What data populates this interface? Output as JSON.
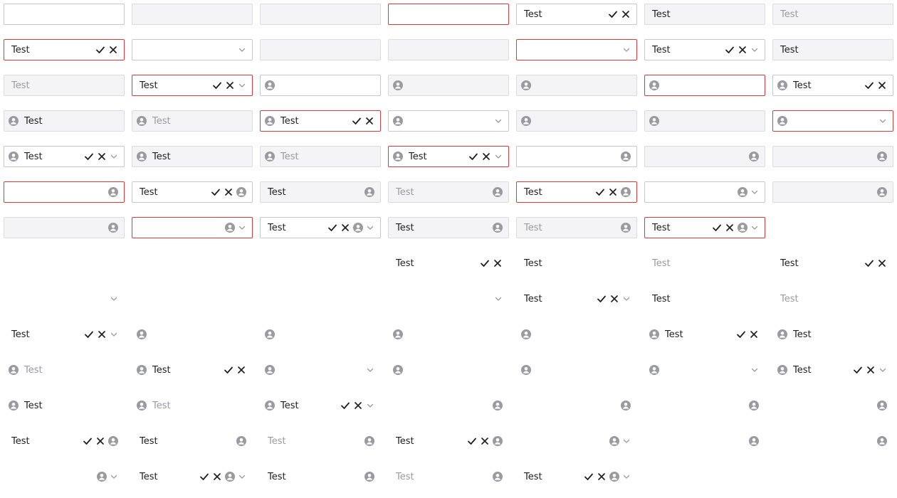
{
  "colors": {
    "error_border": "#d93a3a",
    "default_border": "#c8c8cc",
    "disabled_bg": "#f4f4f6",
    "placeholder": "#9a9aa2",
    "icon_gray": "#9a9aa2"
  },
  "icons": {
    "check": "check-icon",
    "close": "close-icon",
    "user": "user-icon",
    "chevron": "chevron-down-icon"
  },
  "rows": [
    [
      {
        "variant": "default",
        "value": "",
        "lead": false,
        "actions": false,
        "end": false,
        "chev": false
      },
      {
        "variant": "disabled",
        "value": "",
        "lead": false,
        "actions": false,
        "end": false,
        "chev": false
      },
      {
        "variant": "disabled",
        "value": "",
        "lead": false,
        "actions": false,
        "end": false,
        "chev": false
      },
      {
        "variant": "error",
        "value": "",
        "lead": false,
        "actions": false,
        "end": false,
        "chev": false
      },
      {
        "variant": "default",
        "value": "Test",
        "lead": false,
        "actions": true,
        "end": false,
        "chev": false
      },
      {
        "variant": "disabled",
        "value": "Test",
        "lead": false,
        "actions": false,
        "end": false,
        "chev": false
      },
      {
        "variant": "disabled",
        "value": "Test",
        "ph": true,
        "lead": false,
        "actions": false,
        "end": false,
        "chev": false
      }
    ],
    [
      {
        "variant": "error",
        "value": "Test",
        "lead": false,
        "actions": true,
        "end": false,
        "chev": false
      },
      {
        "variant": "default",
        "value": "",
        "lead": false,
        "actions": false,
        "end": false,
        "chev": true
      },
      {
        "variant": "disabled",
        "value": "",
        "lead": false,
        "actions": false,
        "end": false,
        "chev": false
      },
      {
        "variant": "disabled",
        "value": "",
        "lead": false,
        "actions": false,
        "end": false,
        "chev": false
      },
      {
        "variant": "error",
        "value": "",
        "lead": false,
        "actions": false,
        "end": false,
        "chev": true
      },
      {
        "variant": "default",
        "value": "Test",
        "lead": false,
        "actions": true,
        "end": false,
        "chev": true
      },
      {
        "variant": "disabled",
        "value": "Test",
        "lead": false,
        "actions": false,
        "end": false,
        "chev": false
      }
    ],
    [
      {
        "variant": "disabled",
        "value": "Test",
        "ph": true,
        "lead": false,
        "actions": false,
        "end": false,
        "chev": false
      },
      {
        "variant": "error",
        "value": "Test",
        "lead": false,
        "actions": true,
        "end": false,
        "chev": true
      },
      {
        "variant": "default",
        "value": "",
        "lead": true,
        "actions": false,
        "end": false,
        "chev": false
      },
      {
        "variant": "disabled",
        "value": "",
        "lead": true,
        "actions": false,
        "end": false,
        "chev": false
      },
      {
        "variant": "disabled",
        "value": "",
        "lead": true,
        "actions": false,
        "end": false,
        "chev": false
      },
      {
        "variant": "error",
        "value": "",
        "lead": true,
        "actions": false,
        "end": false,
        "chev": false
      },
      {
        "variant": "default",
        "value": "Test",
        "lead": true,
        "actions": true,
        "end": false,
        "chev": false
      }
    ],
    [
      {
        "variant": "disabled",
        "value": "Test",
        "lead": true,
        "actions": false,
        "end": false,
        "chev": false
      },
      {
        "variant": "disabled",
        "value": "Test",
        "ph": true,
        "lead": true,
        "actions": false,
        "end": false,
        "chev": false
      },
      {
        "variant": "error",
        "value": "Test",
        "lead": true,
        "actions": true,
        "end": false,
        "chev": false
      },
      {
        "variant": "default",
        "value": "",
        "lead": true,
        "actions": false,
        "end": false,
        "chev": true
      },
      {
        "variant": "disabled",
        "value": "",
        "lead": true,
        "actions": false,
        "end": false,
        "chev": false
      },
      {
        "variant": "disabled",
        "value": "",
        "lead": true,
        "actions": false,
        "end": false,
        "chev": false
      },
      {
        "variant": "error",
        "value": "",
        "lead": true,
        "actions": false,
        "end": false,
        "chev": true
      }
    ],
    [
      {
        "variant": "default",
        "value": "Test",
        "lead": true,
        "actions": true,
        "end": false,
        "chev": true
      },
      {
        "variant": "disabled",
        "value": "Test",
        "lead": true,
        "actions": false,
        "end": false,
        "chev": false
      },
      {
        "variant": "disabled",
        "value": "Test",
        "ph": true,
        "lead": true,
        "actions": false,
        "end": false,
        "chev": false
      },
      {
        "variant": "error",
        "value": "Test",
        "lead": true,
        "actions": true,
        "end": false,
        "chev": true
      },
      {
        "variant": "default",
        "value": "",
        "lead": false,
        "actions": false,
        "end": true,
        "chev": false
      },
      {
        "variant": "disabled",
        "value": "",
        "lead": false,
        "actions": false,
        "end": true,
        "chev": false
      },
      {
        "variant": "disabled",
        "value": "",
        "lead": false,
        "actions": false,
        "end": true,
        "chev": false
      }
    ],
    [
      {
        "variant": "error",
        "value": "",
        "lead": false,
        "actions": false,
        "end": true,
        "chev": false
      },
      {
        "variant": "default",
        "value": "Test",
        "lead": false,
        "actions": true,
        "end": true,
        "chev": false
      },
      {
        "variant": "disabled",
        "value": "Test",
        "lead": false,
        "actions": false,
        "end": true,
        "chev": false
      },
      {
        "variant": "disabled",
        "value": "Test",
        "ph": true,
        "lead": false,
        "actions": false,
        "end": true,
        "chev": false
      },
      {
        "variant": "error",
        "value": "Test",
        "lead": false,
        "actions": true,
        "end": true,
        "chev": false
      },
      {
        "variant": "default",
        "value": "",
        "lead": false,
        "actions": false,
        "end": true,
        "chev": true
      },
      {
        "variant": "disabled",
        "value": "",
        "lead": false,
        "actions": false,
        "end": true,
        "chev": false
      }
    ],
    [
      {
        "variant": "disabled",
        "value": "",
        "lead": false,
        "actions": false,
        "end": true,
        "chev": false
      },
      {
        "variant": "error",
        "value": "",
        "lead": false,
        "actions": false,
        "end": true,
        "chev": true
      },
      {
        "variant": "default",
        "value": "Test",
        "lead": false,
        "actions": true,
        "end": true,
        "chev": true
      },
      {
        "variant": "disabled",
        "value": "Test",
        "lead": false,
        "actions": false,
        "end": true,
        "chev": false
      },
      {
        "variant": "disabled",
        "value": "Test",
        "ph": true,
        "lead": false,
        "actions": false,
        "end": true,
        "chev": false
      },
      {
        "variant": "error",
        "value": "Test",
        "lead": false,
        "actions": true,
        "end": true,
        "chev": true
      },
      null
    ],
    [
      {
        "variant": "plain",
        "value": "",
        "lead": false,
        "actions": false,
        "end": false,
        "chev": false
      },
      {
        "variant": "plain",
        "value": "",
        "lead": false,
        "actions": false,
        "end": false,
        "chev": false
      },
      {
        "variant": "plain",
        "value": "",
        "lead": false,
        "actions": false,
        "end": false,
        "chev": false
      },
      {
        "variant": "plain",
        "value": "Test",
        "lead": false,
        "actions": true,
        "end": false,
        "chev": false
      },
      {
        "variant": "plain",
        "value": "Test",
        "lead": false,
        "actions": false,
        "end": false,
        "chev": false
      },
      {
        "variant": "plain",
        "value": "Test",
        "ph": true,
        "lead": false,
        "actions": false,
        "end": false,
        "chev": false
      },
      {
        "variant": "plain",
        "value": "Test",
        "lead": false,
        "actions": true,
        "end": false,
        "chev": false
      }
    ],
    [
      {
        "variant": "plain",
        "value": "",
        "lead": false,
        "actions": false,
        "end": false,
        "chev": true
      },
      {
        "variant": "plain",
        "value": "",
        "lead": false,
        "actions": false,
        "end": false,
        "chev": false
      },
      {
        "variant": "plain",
        "value": "",
        "lead": false,
        "actions": false,
        "end": false,
        "chev": false
      },
      {
        "variant": "plain",
        "value": "",
        "lead": false,
        "actions": false,
        "end": false,
        "chev": true
      },
      {
        "variant": "plain",
        "value": "Test",
        "lead": false,
        "actions": true,
        "end": false,
        "chev": true
      },
      {
        "variant": "plain",
        "value": "Test",
        "lead": false,
        "actions": false,
        "end": false,
        "chev": false
      },
      {
        "variant": "plain",
        "value": "Test",
        "ph": true,
        "lead": false,
        "actions": false,
        "end": false,
        "chev": false
      }
    ],
    [
      {
        "variant": "plain",
        "value": "Test",
        "lead": false,
        "actions": true,
        "end": false,
        "chev": true
      },
      {
        "variant": "plain",
        "value": "",
        "lead": true,
        "actions": false,
        "end": false,
        "chev": false
      },
      {
        "variant": "plain",
        "value": "",
        "lead": true,
        "actions": false,
        "end": false,
        "chev": false
      },
      {
        "variant": "plain",
        "value": "",
        "lead": true,
        "actions": false,
        "end": false,
        "chev": false
      },
      {
        "variant": "plain",
        "value": "",
        "lead": true,
        "actions": false,
        "end": false,
        "chev": false
      },
      {
        "variant": "plain",
        "value": "Test",
        "lead": true,
        "actions": true,
        "end": false,
        "chev": false
      },
      {
        "variant": "plain",
        "value": "Test",
        "lead": true,
        "actions": false,
        "end": false,
        "chev": false
      }
    ],
    [
      {
        "variant": "plain",
        "value": "Test",
        "ph": true,
        "lead": true,
        "actions": false,
        "end": false,
        "chev": false
      },
      {
        "variant": "plain",
        "value": "Test",
        "lead": true,
        "actions": true,
        "end": false,
        "chev": false
      },
      {
        "variant": "plain",
        "value": "",
        "lead": true,
        "actions": false,
        "end": false,
        "chev": true
      },
      {
        "variant": "plain",
        "value": "",
        "lead": true,
        "actions": false,
        "end": false,
        "chev": false
      },
      {
        "variant": "plain",
        "value": "",
        "lead": true,
        "actions": false,
        "end": false,
        "chev": false
      },
      {
        "variant": "plain",
        "value": "",
        "lead": true,
        "actions": false,
        "end": false,
        "chev": true
      },
      {
        "variant": "plain",
        "value": "Test",
        "lead": true,
        "actions": true,
        "end": false,
        "chev": true
      }
    ],
    [
      {
        "variant": "plain",
        "value": "Test",
        "lead": true,
        "actions": false,
        "end": false,
        "chev": false
      },
      {
        "variant": "plain",
        "value": "Test",
        "ph": true,
        "lead": true,
        "actions": false,
        "end": false,
        "chev": false
      },
      {
        "variant": "plain",
        "value": "Test",
        "lead": true,
        "actions": true,
        "end": false,
        "chev": true
      },
      {
        "variant": "plain",
        "value": "",
        "lead": false,
        "actions": false,
        "end": true,
        "chev": false
      },
      {
        "variant": "plain",
        "value": "",
        "lead": false,
        "actions": false,
        "end": true,
        "chev": false
      },
      {
        "variant": "plain",
        "value": "",
        "lead": false,
        "actions": false,
        "end": true,
        "chev": false
      },
      {
        "variant": "plain",
        "value": "",
        "lead": false,
        "actions": false,
        "end": true,
        "chev": false
      }
    ],
    [
      {
        "variant": "plain",
        "value": "Test",
        "lead": false,
        "actions": true,
        "end": true,
        "chev": false
      },
      {
        "variant": "plain",
        "value": "Test",
        "lead": false,
        "actions": false,
        "end": true,
        "chev": false
      },
      {
        "variant": "plain",
        "value": "Test",
        "ph": true,
        "lead": false,
        "actions": false,
        "end": true,
        "chev": false
      },
      {
        "variant": "plain",
        "value": "Test",
        "lead": false,
        "actions": true,
        "end": true,
        "chev": false
      },
      {
        "variant": "plain",
        "value": "",
        "lead": false,
        "actions": false,
        "end": true,
        "chev": true
      },
      {
        "variant": "plain",
        "value": "",
        "lead": false,
        "actions": false,
        "end": true,
        "chev": false
      },
      {
        "variant": "plain",
        "value": "",
        "lead": false,
        "actions": false,
        "end": true,
        "chev": false
      }
    ],
    [
      {
        "variant": "plain",
        "value": "",
        "lead": false,
        "actions": false,
        "end": true,
        "chev": true
      },
      {
        "variant": "plain",
        "value": "Test",
        "lead": false,
        "actions": true,
        "end": true,
        "chev": true
      },
      {
        "variant": "plain",
        "value": "Test",
        "lead": false,
        "actions": false,
        "end": true,
        "chev": false
      },
      {
        "variant": "plain",
        "value": "Test",
        "ph": true,
        "lead": false,
        "actions": false,
        "end": true,
        "chev": false
      },
      {
        "variant": "plain",
        "value": "Test",
        "lead": false,
        "actions": true,
        "end": true,
        "chev": true
      },
      null,
      null
    ]
  ]
}
